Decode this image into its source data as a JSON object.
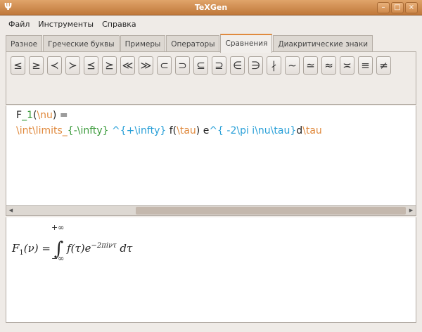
{
  "window": {
    "title": "TeXGen",
    "icon": "psi-icon"
  },
  "menu": [
    {
      "label": "Файл"
    },
    {
      "label": "Инструменты"
    },
    {
      "label": "Справка"
    }
  ],
  "tabs": [
    {
      "label": "Разное"
    },
    {
      "label": "Греческие буквы"
    },
    {
      "label": "Примеры"
    },
    {
      "label": "Операторы"
    },
    {
      "label": "Сравнения",
      "active": true
    },
    {
      "label": "Диакритические знаки"
    }
  ],
  "symbols": [
    "≤",
    "≥",
    "≺",
    "≻",
    "⪯",
    "⪰",
    "≪",
    "≫",
    "⊂",
    "⊃",
    "⊆",
    "⊇",
    "∈",
    "∋",
    "∤",
    "∼",
    "≃",
    "≈",
    "≍",
    "≡",
    "≠"
  ],
  "editor": {
    "lines": [
      [
        {
          "t": "F",
          "c": "#222"
        },
        {
          "t": "_1",
          "c": "#3a9a3a"
        },
        {
          "t": "(",
          "c": "#222"
        },
        {
          "t": "\\nu",
          "c": "#e08a3e"
        },
        {
          "t": ") =",
          "c": "#222"
        }
      ],
      [
        {
          "t": "\\int\\limits_",
          "c": "#e08a3e"
        },
        {
          "t": "{-\\infty}",
          "c": "#3a9a3a"
        },
        {
          "t": " ^{+\\infty}",
          "c": "#2aa0d8"
        },
        {
          "t": " f(",
          "c": "#222"
        },
        {
          "t": "\\tau",
          "c": "#e08a3e"
        },
        {
          "t": ") e",
          "c": "#222"
        },
        {
          "t": "^{ -2\\pi i\\nu\\tau}",
          "c": "#2aa0d8"
        },
        {
          "t": "d",
          "c": "#222"
        },
        {
          "t": "\\tau",
          "c": "#e08a3e"
        }
      ]
    ]
  },
  "preview": {
    "lhs": "F",
    "sub": "1",
    "arg": "(ν) =",
    "upper": "+∞",
    "lower": "−∞",
    "integral": "∫",
    "body": "f(τ)e",
    "exp": "−2πiντ",
    "tail": " dτ"
  }
}
